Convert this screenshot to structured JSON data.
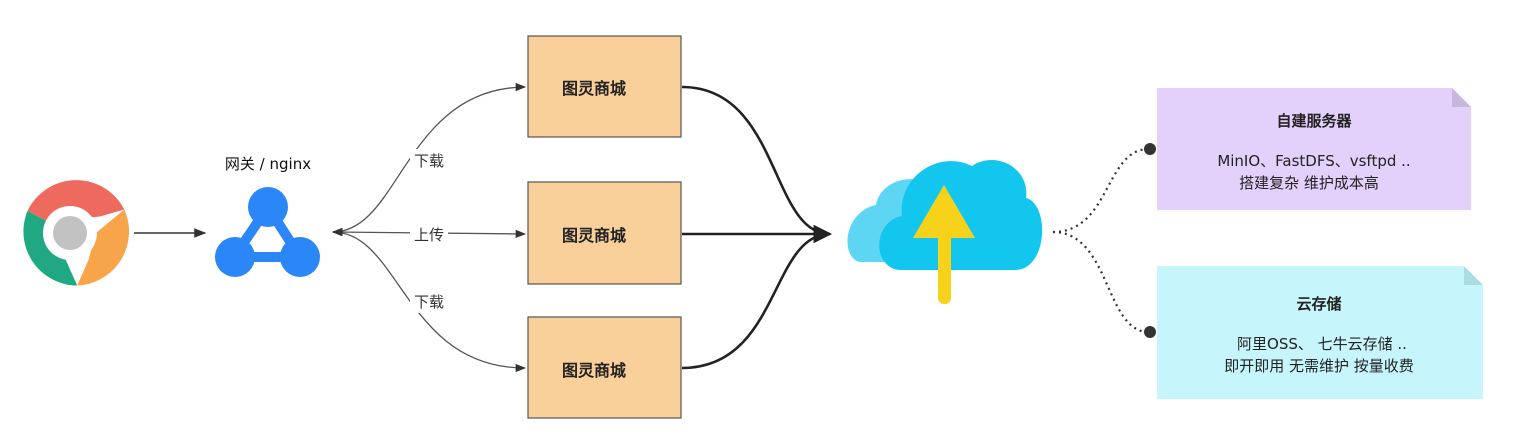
{
  "gateway": {
    "label": "网关 / nginx",
    "icon": "network-hub-icon",
    "color": "#2b87f7"
  },
  "browser": {
    "icon": "chrome-browser-icon"
  },
  "edges": {
    "download_top": "下载",
    "upload": "上传",
    "download_bottom": "下载"
  },
  "services": [
    {
      "label": "图灵商城"
    },
    {
      "label": "图灵商城"
    },
    {
      "label": "图灵商城"
    }
  ],
  "storage": {
    "icon": "cloud-upload-icon",
    "cloud_color": "#12c6ee",
    "arrow_color": "#f6d21a"
  },
  "notes": {
    "self_hosted": {
      "title": "自建服务器",
      "line1": "MinIO、FastDFS、vsftpd ..",
      "line2": "搭建复杂  维护成本高",
      "color": "#e3d1fb"
    },
    "cloud": {
      "title": "云存储",
      "line1": "阿里OSS、 七牛云存储 ..",
      "line2": "即开即用  无需维护  按量收费",
      "color": "#c6f6fb"
    }
  },
  "colors": {
    "service_box": "#f9cf9a",
    "service_border": "#555555"
  }
}
